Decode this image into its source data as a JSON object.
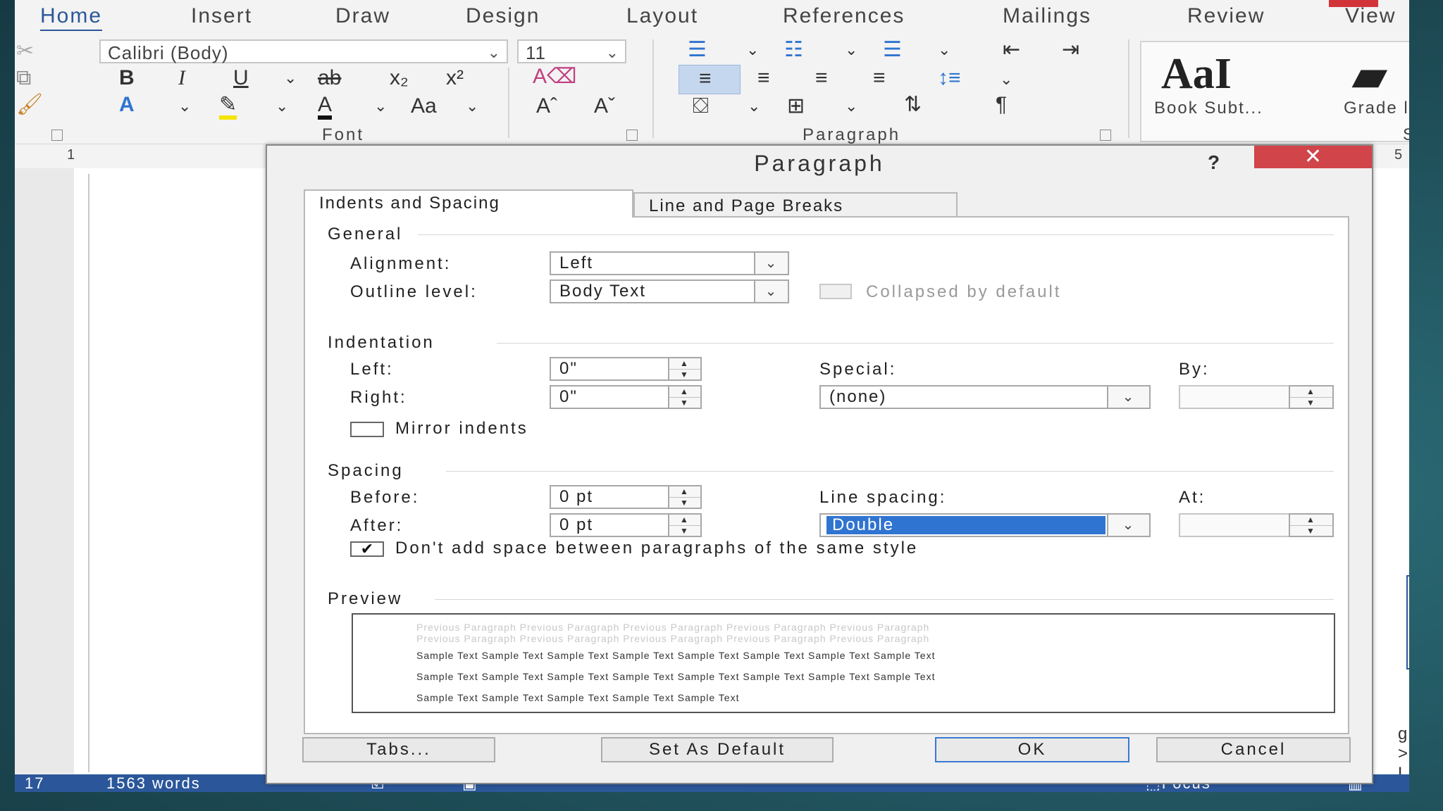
{
  "ribbon": {
    "tabs": [
      "Home",
      "Insert",
      "Draw",
      "Design",
      "Layout",
      "References",
      "Mailings",
      "Review",
      "View"
    ],
    "font_name": "Calibri (Body)",
    "font_size": "11",
    "group_font": "Font",
    "group_paragraph": "Paragraph",
    "group_styles": "Style",
    "style_sample_1": "AaI",
    "style_name_1": "Book Subt...",
    "style_name_2": "Grade l",
    "btn_bold": "B",
    "btn_italic": "I",
    "btn_underline": "U",
    "btn_strike": "ab",
    "btn_subscript": "x₂",
    "btn_superscript": "x²",
    "btn_change_case": "Aa",
    "btn_grow": "Aˆ",
    "btn_shrink": "Aˇ",
    "btn_pilcrow": "¶"
  },
  "ruler": {
    "left_mark": "1",
    "right_mark": "5"
  },
  "status": {
    "page": "17",
    "words": "1563 words",
    "focus": "Focus"
  },
  "peek_text": "g > L",
  "dialog": {
    "title": "Paragraph",
    "help": "?",
    "close": "✕",
    "tab_indents": "Indents and Spacing",
    "tab_breaks": "Line and Page Breaks",
    "general": {
      "heading": "General",
      "alignment_label": "Alignment:",
      "alignment_value": "Left",
      "outline_label": "Outline level:",
      "outline_value": "Body Text",
      "collapsed_label": "Collapsed by default"
    },
    "indentation": {
      "heading": "Indentation",
      "left_label": "Left:",
      "left_value": "0\"",
      "right_label": "Right:",
      "right_value": "0\"",
      "special_label": "Special:",
      "special_value": "(none)",
      "by_label": "By:",
      "by_value": "",
      "mirror_label": "Mirror indents"
    },
    "spacing": {
      "heading": "Spacing",
      "before_label": "Before:",
      "before_value": "0 pt",
      "after_label": "After:",
      "after_value": "0 pt",
      "line_label": "Line spacing:",
      "line_value": "Double",
      "at_label": "At:",
      "at_value": "",
      "dont_add_label": "Don't add space between paragraphs of the same style",
      "dont_add_checked": "✔"
    },
    "preview": {
      "heading": "Preview",
      "prev_1": "Previous Paragraph Previous Paragraph Previous Paragraph Previous Paragraph Previous Paragraph",
      "prev_2": "Previous Paragraph Previous Paragraph Previous Paragraph Previous Paragraph Previous Paragraph",
      "sample_1": "Sample Text Sample Text Sample Text Sample Text Sample Text Sample Text Sample Text Sample Text",
      "sample_2": "Sample Text Sample Text Sample Text Sample Text Sample Text Sample Text Sample Text Sample Text",
      "sample_3": "Sample Text Sample Text Sample Text Sample Text Sample Text"
    },
    "buttons": {
      "tabs": "Tabs...",
      "set_default": "Set As Default",
      "ok": "OK",
      "cancel": "Cancel"
    }
  },
  "colors": {
    "accent": "#2b579a",
    "close_red": "#d0444a",
    "selection": "#3074d1"
  }
}
